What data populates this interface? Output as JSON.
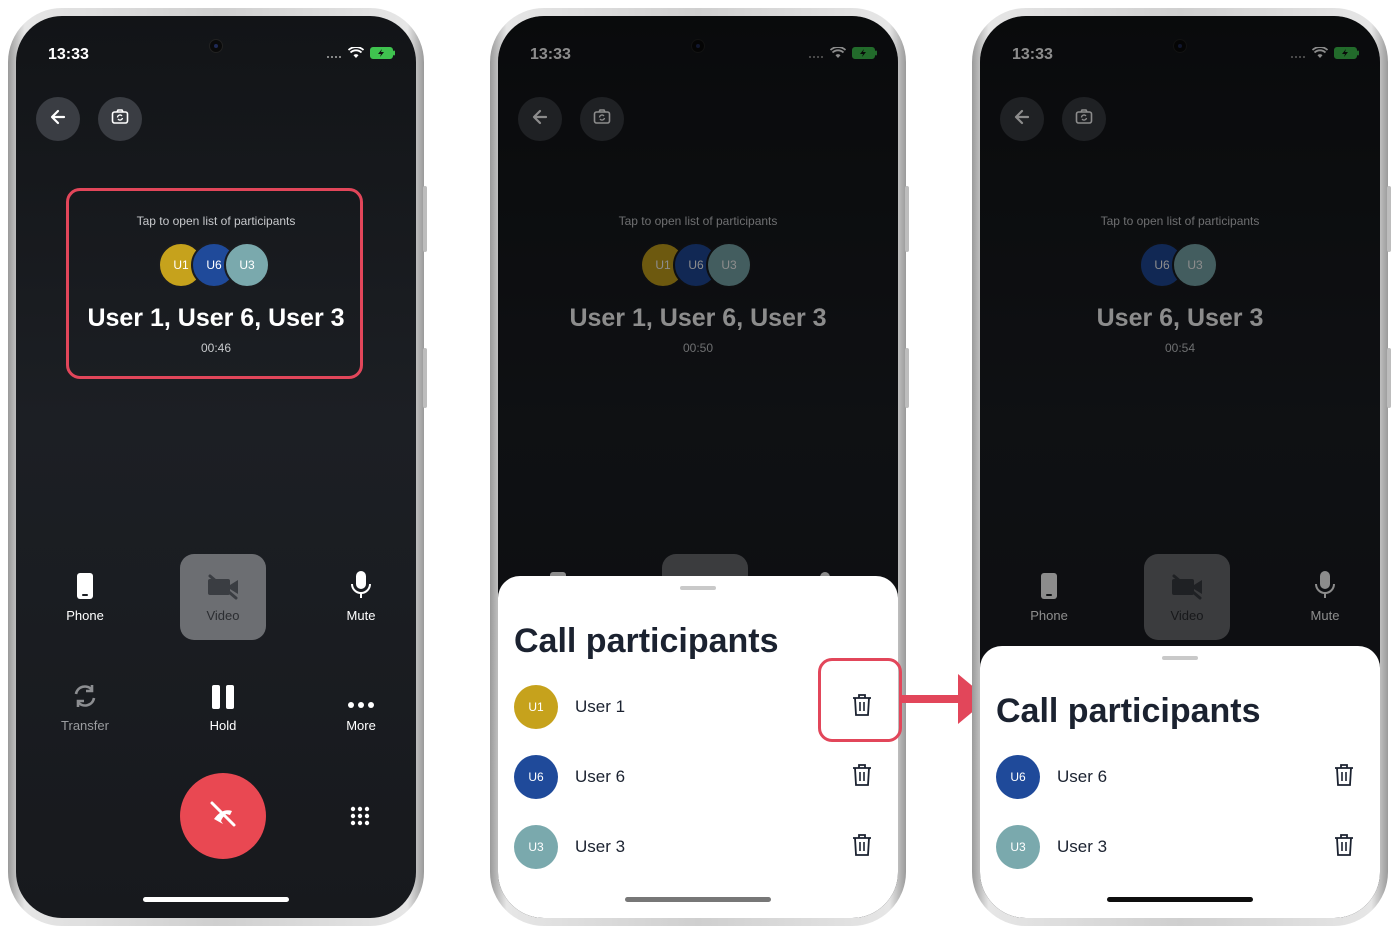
{
  "colors": {
    "u1": "#c6a21c",
    "u6": "#1f4a9a",
    "u3": "#7aa9ad",
    "end_call": "#e94852",
    "highlight": "#e2465a"
  },
  "screens": [
    {
      "status": {
        "time": "13:33"
      },
      "header": {
        "back_icon": "arrow-left-icon",
        "switch_camera_icon": "camera-switch-icon"
      },
      "call": {
        "hint": "Tap to open list of participants",
        "avatars": [
          "U1",
          "U6",
          "U3"
        ],
        "names": "User 1, User 6, User 3",
        "timer": "00:46"
      },
      "controls": {
        "phone": "Phone",
        "video": "Video",
        "mute": "Mute",
        "transfer": "Transfer",
        "hold": "Hold",
        "more": "More"
      }
    },
    {
      "status": {
        "time": "13:33"
      },
      "call": {
        "hint": "Tap to open list of participants",
        "avatars": [
          "U1",
          "U6",
          "U3"
        ],
        "names": "User 1, User 6, User 3",
        "timer": "00:50"
      },
      "sheet": {
        "title": "Call participants",
        "participants": [
          {
            "initials": "U1",
            "name": "User 1"
          },
          {
            "initials": "U6",
            "name": "User 6"
          },
          {
            "initials": "U3",
            "name": "User 3"
          }
        ]
      }
    },
    {
      "status": {
        "time": "13:33"
      },
      "call": {
        "hint": "Tap to open list of participants",
        "avatars": [
          "U6",
          "U3"
        ],
        "names": "User 6, User 3",
        "timer": "00:54"
      },
      "controls": {
        "phone": "Phone",
        "video": "Video",
        "mute": "Mute"
      },
      "sheet": {
        "title": "Call participants",
        "participants": [
          {
            "initials": "U6",
            "name": "User 6"
          },
          {
            "initials": "U3",
            "name": "User 3"
          }
        ]
      }
    }
  ]
}
